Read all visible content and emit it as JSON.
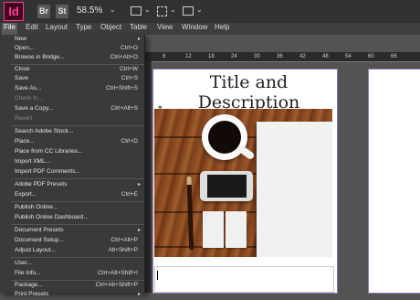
{
  "app": {
    "logo": "Id",
    "bridge": "Br",
    "stock": "St",
    "zoom": "58.5%"
  },
  "menubar": [
    "File",
    "Edit",
    "Layout",
    "Type",
    "Object",
    "Table",
    "View",
    "Window",
    "Help"
  ],
  "ruler_ticks": [
    "6",
    "12",
    "18",
    "24",
    "30",
    "36",
    "42",
    "48",
    "54",
    "60",
    "66"
  ],
  "document": {
    "title": "Title and Description"
  },
  "file_menu": [
    {
      "label": "New",
      "shortcut": "",
      "submenu": true
    },
    {
      "label": "Open...",
      "shortcut": "Ctrl+O"
    },
    {
      "label": "Browse in Bridge...",
      "shortcut": "Ctrl+Alt+O"
    },
    {
      "label": "Close",
      "shortcut": "Ctrl+W"
    },
    {
      "label": "Save",
      "shortcut": "Ctrl+S"
    },
    {
      "label": "Save As...",
      "shortcut": "Ctrl+Shift+S"
    },
    {
      "label": "Check In...",
      "shortcut": "",
      "disabled": true
    },
    {
      "label": "Save a Copy...",
      "shortcut": "Ctrl+Alt+S"
    },
    {
      "label": "Revert",
      "shortcut": "",
      "disabled": true
    },
    {
      "label": "Search Adobe Stock...",
      "shortcut": ""
    },
    {
      "label": "Place...",
      "shortcut": "Ctrl+D"
    },
    {
      "label": "Place from CC Libraries...",
      "shortcut": ""
    },
    {
      "label": "Import XML...",
      "shortcut": ""
    },
    {
      "label": "Import PDF Comments...",
      "shortcut": ""
    },
    {
      "label": "Adobe PDF Presets",
      "shortcut": "",
      "submenu": true
    },
    {
      "label": "Export...",
      "shortcut": "Ctrl+E"
    },
    {
      "label": "Publish Online...",
      "shortcut": ""
    },
    {
      "label": "Publish Online Dashboard...",
      "shortcut": ""
    },
    {
      "label": "Document Presets",
      "shortcut": "",
      "submenu": true
    },
    {
      "label": "Document Setup...",
      "shortcut": "Ctrl+Alt+P"
    },
    {
      "label": "Adjust Layout...",
      "shortcut": "Alt+Shift+P"
    },
    {
      "label": "User...",
      "shortcut": ""
    },
    {
      "label": "File Info...",
      "shortcut": "Ctrl+Alt+Shift+I"
    },
    {
      "label": "Package...",
      "shortcut": "Ctrl+Alt+Shift+P"
    },
    {
      "label": "Print Presets",
      "shortcut": "",
      "submenu": true
    }
  ],
  "icons": {
    "frame": "frame-icon",
    "screen_mode": "screen-mode-icon",
    "workspace": "arrange-icon",
    "link": "link-icon"
  },
  "colors": {
    "accent_indesign": "#ff3d8f",
    "page_frame": "#9a72b2"
  }
}
